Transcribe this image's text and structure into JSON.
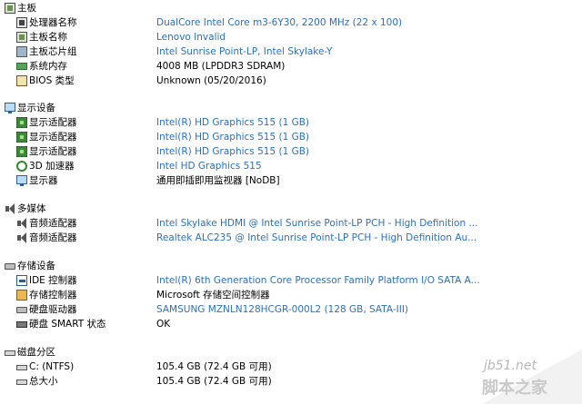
{
  "groups": [
    {
      "title": "主板",
      "icon": "motherboard-icon",
      "items": [
        {
          "label": "处理器名称",
          "value": "DualCore Intel Core m3-6Y30, 2200 MHz (22 x 100)",
          "link": true,
          "icon": "cpu-icon"
        },
        {
          "label": "主板名称",
          "value": "Lenovo Invalid",
          "link": true,
          "icon": "motherboard-icon"
        },
        {
          "label": "主板芯片组",
          "value": "Intel Sunrise Point-LP, Intel Skylake-Y",
          "link": true,
          "icon": "chipset-icon"
        },
        {
          "label": "系统内存",
          "value": "4008 MB  (LPDDR3 SDRAM)",
          "link": false,
          "icon": "memory-icon"
        },
        {
          "label": "BIOS 类型",
          "value": "Unknown (05/20/2016)",
          "link": false,
          "icon": "bios-icon"
        }
      ]
    },
    {
      "title": "显示设备",
      "icon": "monitor-icon",
      "items": [
        {
          "label": "显示适配器",
          "value": "Intel(R) HD Graphics 515  (1 GB)",
          "link": true,
          "icon": "display-adapter-icon"
        },
        {
          "label": "显示适配器",
          "value": "Intel(R) HD Graphics 515  (1 GB)",
          "link": true,
          "icon": "display-adapter-icon"
        },
        {
          "label": "显示适配器",
          "value": "Intel(R) HD Graphics 515  (1 GB)",
          "link": true,
          "icon": "display-adapter-icon"
        },
        {
          "label": "3D 加速器",
          "value": "Intel HD Graphics 515",
          "link": true,
          "icon": "3d-accelerator-icon"
        },
        {
          "label": "显示器",
          "value": "通用即插即用监视器 [NoDB]",
          "link": false,
          "icon": "monitor-icon"
        }
      ]
    },
    {
      "title": "多媒体",
      "icon": "speaker-icon",
      "items": [
        {
          "label": "音频适配器",
          "value": "Intel Skylake HDMI @ Intel Sunrise Point-LP PCH - High Definition ...",
          "link": true,
          "icon": "speaker-icon"
        },
        {
          "label": "音频适配器",
          "value": "Realtek ALC235 @ Intel Sunrise Point-LP PCH - High Definition Au...",
          "link": true,
          "icon": "speaker-icon"
        }
      ]
    },
    {
      "title": "存储设备",
      "icon": "storage-icon",
      "items": [
        {
          "label": "IDE 控制器",
          "value": "Intel(R) 6th Generation Core Processor Family Platform I/O SATA A...",
          "link": true,
          "icon": "ide-controller-icon"
        },
        {
          "label": "存储控制器",
          "value": "Microsoft 存储空间控制器",
          "link": false,
          "icon": "storage-controller-icon"
        },
        {
          "label": "硬盘驱动器",
          "value": "SAMSUNG MZNLN128HCGR-000L2  (128 GB, SATA-III)",
          "link": true,
          "icon": "disk-drive-icon"
        },
        {
          "label": "硬盘 SMART 状态",
          "value": "OK",
          "link": false,
          "icon": "smart-status-icon"
        }
      ]
    },
    {
      "title": "磁盘分区",
      "icon": "partition-icon",
      "items": [
        {
          "label": "C: (NTFS)",
          "value": "105.4 GB (72.4 GB 可用)",
          "link": false,
          "icon": "partition-icon"
        },
        {
          "label": "总大小",
          "value": "105.4 GB (72.4 GB 可用)",
          "link": false,
          "icon": "partition-icon"
        }
      ]
    }
  ],
  "watermark": {
    "line1": "jb51.net",
    "line2": "脚本之家"
  }
}
